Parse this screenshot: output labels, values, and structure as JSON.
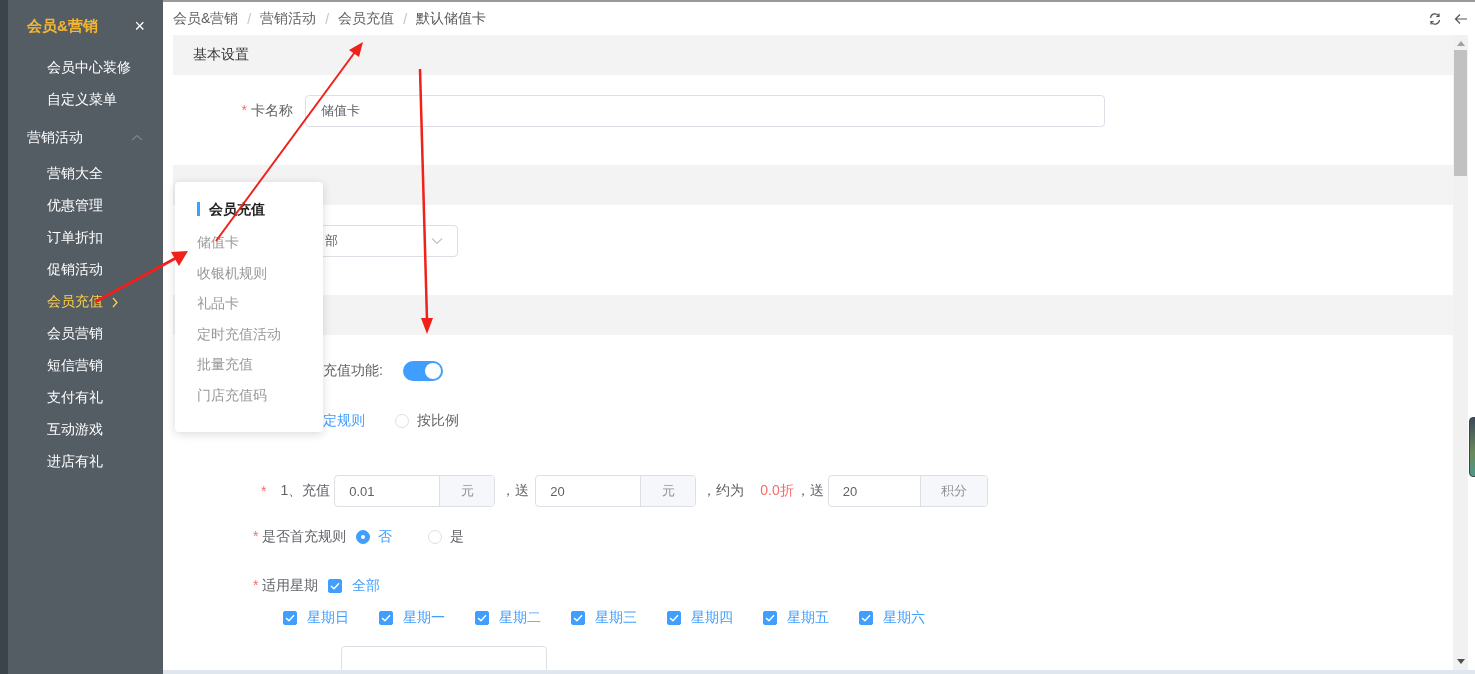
{
  "sidebar": {
    "title": "会员&营销",
    "close": "×",
    "items": [
      {
        "label": "会员中心装修",
        "selected": false
      },
      {
        "label": "自定义菜单",
        "selected": false
      }
    ],
    "group": {
      "label": "营销活动",
      "expanded": true,
      "children": [
        {
          "label": "营销大全",
          "selected": false,
          "has_submenu": false
        },
        {
          "label": "优惠管理",
          "selected": false,
          "has_submenu": false
        },
        {
          "label": "订单折扣",
          "selected": false,
          "has_submenu": false
        },
        {
          "label": "促销活动",
          "selected": false,
          "has_submenu": false
        },
        {
          "label": "会员充值",
          "selected": true,
          "has_submenu": true
        },
        {
          "label": "会员营销",
          "selected": false,
          "has_submenu": false
        },
        {
          "label": "短信营销",
          "selected": false,
          "has_submenu": false
        },
        {
          "label": "支付有礼",
          "selected": false,
          "has_submenu": false
        },
        {
          "label": "互动游戏",
          "selected": false,
          "has_submenu": false
        },
        {
          "label": "进店有礼",
          "selected": false,
          "has_submenu": false
        }
      ]
    }
  },
  "breadcrumb": {
    "separator": "/",
    "items": [
      "会员&营销",
      "营销活动",
      "会员充值",
      "默认储值卡"
    ]
  },
  "submenu_popup": {
    "title": "会员充值",
    "items": [
      "储值卡",
      "收银机规则",
      "礼品卡",
      "定时充值活动",
      "批量充值",
      "门店充值码"
    ]
  },
  "form": {
    "section_title": "基本设置",
    "card_name": {
      "label": "卡名称",
      "required_mark": "*",
      "value": "储值卡"
    },
    "settlement_select": {
      "value": "部"
    },
    "recharge_switch": {
      "label": "充值功能:",
      "on": true
    },
    "rule_type": [
      {
        "label": "定规则",
        "selected": true
      },
      {
        "label": "按比例",
        "selected": false
      }
    ],
    "recharge_rule": {
      "required_mark": "*",
      "index_label": "1、充值",
      "amount": "0.01",
      "amount_unit": "元",
      "gift_sep": "，送",
      "gift": "20",
      "gift_unit": "元",
      "discount_prefix": "，约为",
      "discount": "0.0折",
      "points_sep": "，送",
      "points": "20",
      "points_unit": "积分"
    },
    "first_recharge": {
      "label": "是否首充规则",
      "required_mark": "*",
      "options": [
        {
          "label": "否",
          "selected": true
        },
        {
          "label": "是",
          "selected": false
        }
      ]
    },
    "weekdays": {
      "label": "适用星期",
      "required_mark": "*",
      "all": {
        "label": "全部",
        "checked": true
      },
      "days": [
        {
          "label": "星期日",
          "checked": true
        },
        {
          "label": "星期一",
          "checked": true
        },
        {
          "label": "星期二",
          "checked": true
        },
        {
          "label": "星期三",
          "checked": true
        },
        {
          "label": "星期四",
          "checked": true
        },
        {
          "label": "星期五",
          "checked": true
        },
        {
          "label": "星期六",
          "checked": true
        }
      ]
    }
  }
}
